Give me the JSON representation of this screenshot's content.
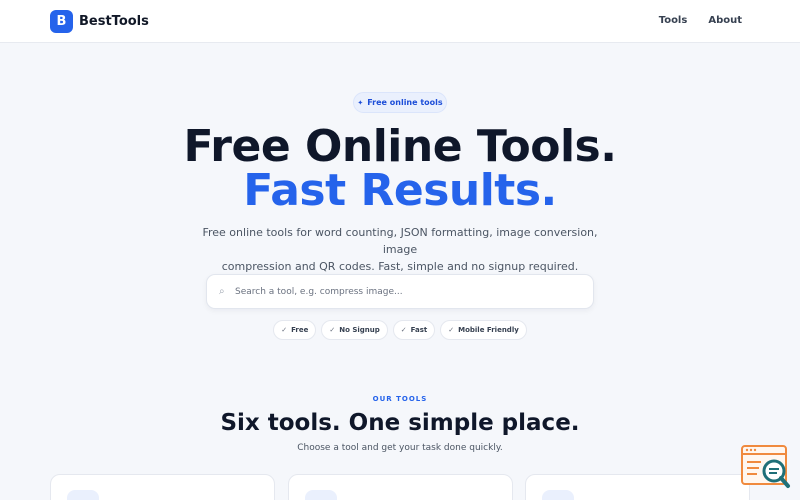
{
  "nav": {
    "brand_letter": "B",
    "brand_name": "BestTools",
    "links": [
      "Tools",
      "About"
    ]
  },
  "hero": {
    "badge": "Free online tools",
    "title_line1": "Free Online Tools.",
    "title_line2": "Fast Results.",
    "subtitle_line1": "Free online tools for word counting, JSON formatting, image conversion, image",
    "subtitle_line2": "compression and QR codes. Fast, simple and no signup required."
  },
  "search": {
    "placeholder": "Search a tool, e.g. compress image...",
    "value": ""
  },
  "features": [
    "Free",
    "No Signup",
    "Fast",
    "Mobile Friendly"
  ],
  "tools_section": {
    "eyebrow": "OUR TOOLS",
    "title": "Six tools. One simple place.",
    "subtitle": "Choose a tool and get your task done quickly."
  },
  "colors": {
    "accent": "#2563eb",
    "heading": "#0f172a",
    "background": "#f5f7fb",
    "widget_orange": "#f08a3e",
    "widget_teal": "#1f6f78"
  },
  "icons": {
    "search": "magnifier-icon",
    "badge": "sparkle-icon",
    "feature": "checkmark-icon",
    "widget": "browser-window-magnifier-icon"
  }
}
